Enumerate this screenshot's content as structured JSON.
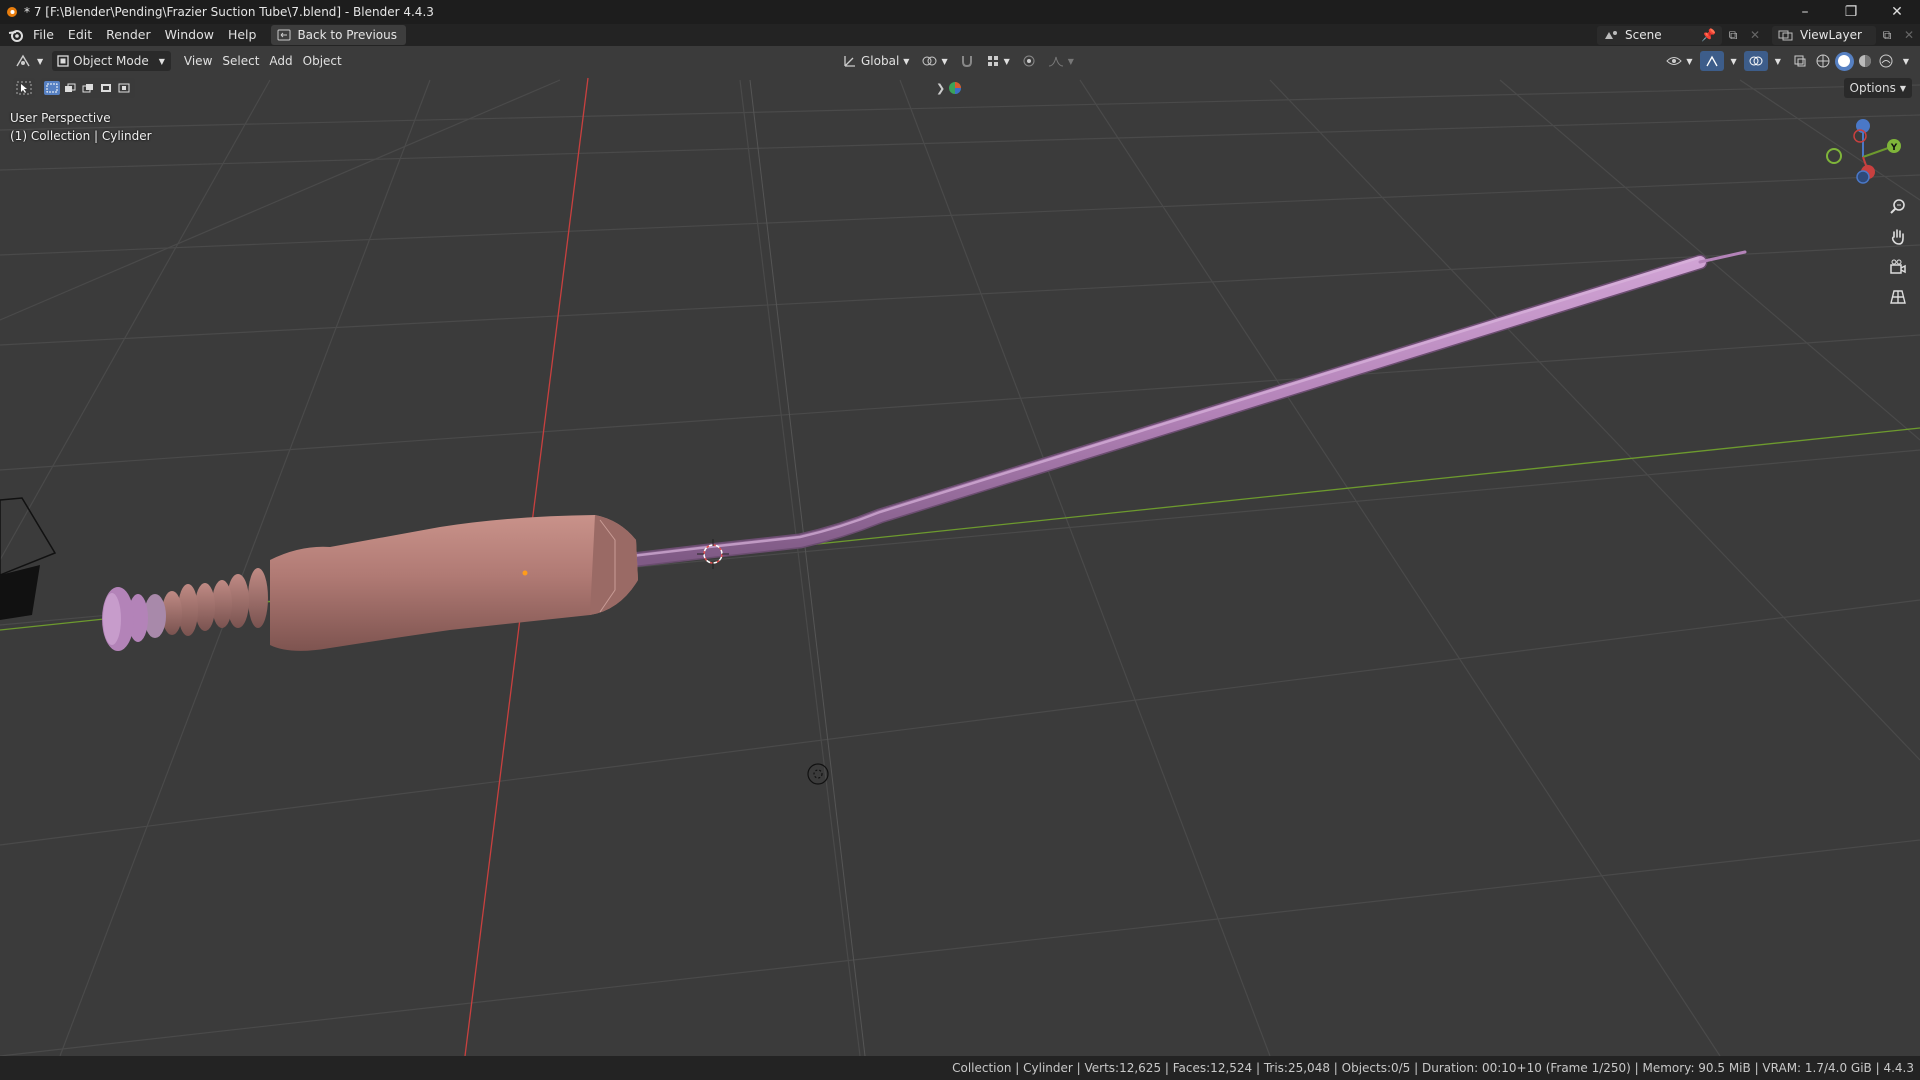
{
  "window": {
    "title": "* 7 [F:\\Blender\\Pending\\Frazier Suction Tube\\7.blend] - Blender 4.4.3"
  },
  "menubar": {
    "items": [
      "File",
      "Edit",
      "Render",
      "Window",
      "Help"
    ],
    "back_button": "Back to Previous",
    "scene_name": "Scene",
    "view_layer": "ViewLayer"
  },
  "viewport_header": {
    "mode": "Object Mode",
    "menus": [
      "View",
      "Select",
      "Add",
      "Object"
    ],
    "orientation": "Global",
    "options_label": "Options"
  },
  "viewport": {
    "perspective": "User Perspective",
    "collection_info": "(1) Collection | Cylinder",
    "gizmo_axis_y": "Y"
  },
  "statusbar": {
    "text": "Collection | Cylinder | Verts:12,625 | Faces:12,524 | Tris:25,048 | Objects:0/5 | Duration: 00:10+10 (Frame 1/250) | Memory: 90.5 MiB | VRAM: 1.7/4.0 GiB | 4.4.3"
  },
  "colors": {
    "viewport_bg": "#3b3b3b",
    "grid_line": "#4a4a4a",
    "x_axis": "#c8403f",
    "y_axis": "#6d9a2e",
    "handle": "#b07a74",
    "tube": "#b383b8"
  }
}
